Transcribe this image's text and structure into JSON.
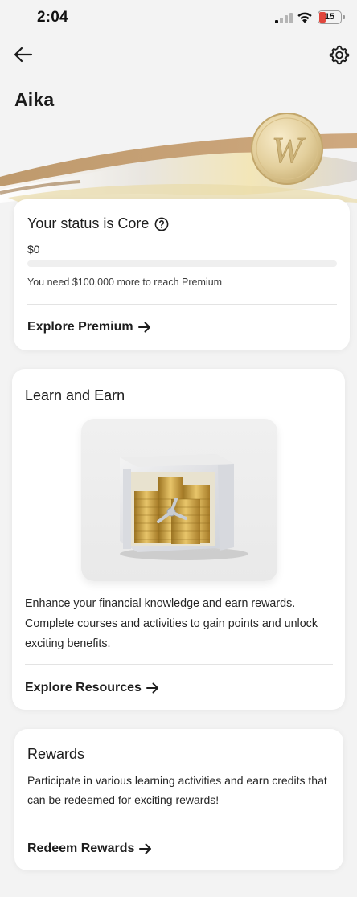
{
  "status_bar": {
    "time": "2:04",
    "battery": "15",
    "icons": [
      "cellular-signal-icon",
      "wifi-icon",
      "battery-icon"
    ]
  },
  "header": {
    "back_icon": "arrow-left-icon",
    "settings_icon": "gear-icon",
    "user_name": "Aika"
  },
  "status_card": {
    "title": "Your status is Core",
    "help_icon": "question-circle-icon",
    "amount": "$0",
    "progress_fraction": 0,
    "note": "You need $100,000 more to reach Premium",
    "link_label": "Explore Premium"
  },
  "learn_card": {
    "title": "Learn and Earn",
    "image": "safe-with-gold-coins",
    "description": "Enhance your financial knowledge and earn rewards. Complete courses and activities to gain points and unlock exciting benefits.",
    "link_label": "Explore Resources"
  },
  "rewards_card": {
    "title": "Rewards",
    "description": "Participate in various learning activities and earn credits that can be redeemed for exciting rewards!",
    "link_label": "Redeem Rewards"
  },
  "colors": {
    "background": "#f3f3f3",
    "card": "#ffffff",
    "gold": "#c9a24c",
    "battery_low": "#e0463c"
  }
}
